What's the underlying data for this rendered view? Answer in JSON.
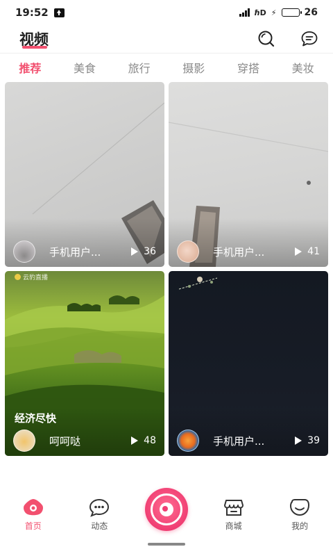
{
  "status_bar": {
    "time": "19:52",
    "battery_level": "26",
    "icons": [
      "upload-icon",
      "signal-icon",
      "hd-icon",
      "charging-icon",
      "battery-icon"
    ]
  },
  "header": {
    "title": "视频",
    "icons": [
      "search-icon",
      "message-icon"
    ]
  },
  "tabs": [
    {
      "label": "推荐",
      "active": true
    },
    {
      "label": "美食",
      "active": false
    },
    {
      "label": "旅行",
      "active": false
    },
    {
      "label": "摄影",
      "active": false
    },
    {
      "label": "穿搭",
      "active": false
    },
    {
      "label": "美妆",
      "active": false
    }
  ],
  "videos": [
    {
      "author": "手机用户...",
      "plays": "36",
      "caption": ""
    },
    {
      "author": "手机用户...",
      "plays": "41",
      "caption": ""
    },
    {
      "author": "呵呵哒",
      "plays": "48",
      "caption": "经济尽快",
      "watermark": "云豹直播"
    },
    {
      "author": "手机用户...",
      "plays": "39",
      "caption": ""
    }
  ],
  "bottom_nav": [
    {
      "label": "首页",
      "icon": "home-icon",
      "active": true
    },
    {
      "label": "动态",
      "icon": "moments-icon",
      "active": false
    },
    {
      "label": "",
      "icon": "record-icon",
      "active": false
    },
    {
      "label": "商城",
      "icon": "store-icon",
      "active": false
    },
    {
      "label": "我的",
      "icon": "profile-icon",
      "active": false
    }
  ],
  "colors": {
    "accent": "#f2506f",
    "tab_inactive": "#8a8a8a",
    "dark_card": "#161b24"
  }
}
